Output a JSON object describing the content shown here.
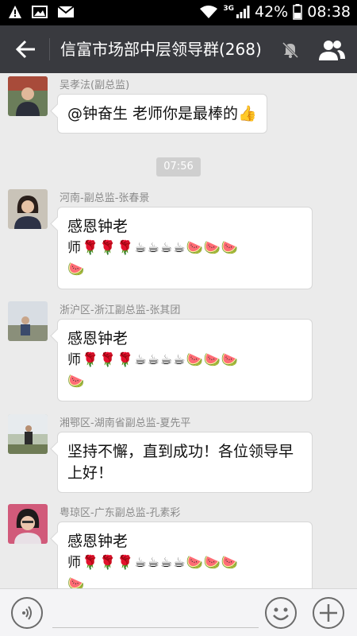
{
  "status": {
    "battery_percent": "42%",
    "time": "08:38",
    "network": "3G"
  },
  "titlebar": {
    "title": "信富市场部中层领导群(268)"
  },
  "timestamp": "07:56",
  "messages": [
    {
      "sender": "吴孝法(副总监)",
      "line1": "@钟奋生 老师你是最棒的👍",
      "line2": ""
    },
    {
      "sender": "河南-副总监-张春景",
      "line1": "感恩钟老",
      "line2": "师🌹🌹🌹☕☕☕☕🍉🍉🍉",
      "line3": "🍉"
    },
    {
      "sender": "浙沪区-浙江副总监-张其团",
      "line1": "感恩钟老",
      "line2": "师🌹🌹🌹☕☕☕☕🍉🍉🍉",
      "line3": "🍉"
    },
    {
      "sender": "湘鄂区-湖南省副总监-夏先平",
      "line1": "坚持不懈，直到成功！各位领导早",
      "line2": "上好！"
    },
    {
      "sender": "粤琼区-广东副总监-孔素彩",
      "line1": "感恩钟老",
      "line2": "师🌹🌹🌹☕☕☕☕🍉🍉🍉",
      "line3": "🍉"
    }
  ],
  "colors": {
    "titlebar": "#393a3f",
    "chat_bg": "#ebebeb",
    "bubble": "#ffffff"
  },
  "icons": {
    "back": "back-arrow-icon",
    "mute": "mute-bell-icon",
    "members": "group-members-icon",
    "voice": "voice-icon",
    "emoji": "emoji-icon",
    "plus": "plus-icon"
  }
}
